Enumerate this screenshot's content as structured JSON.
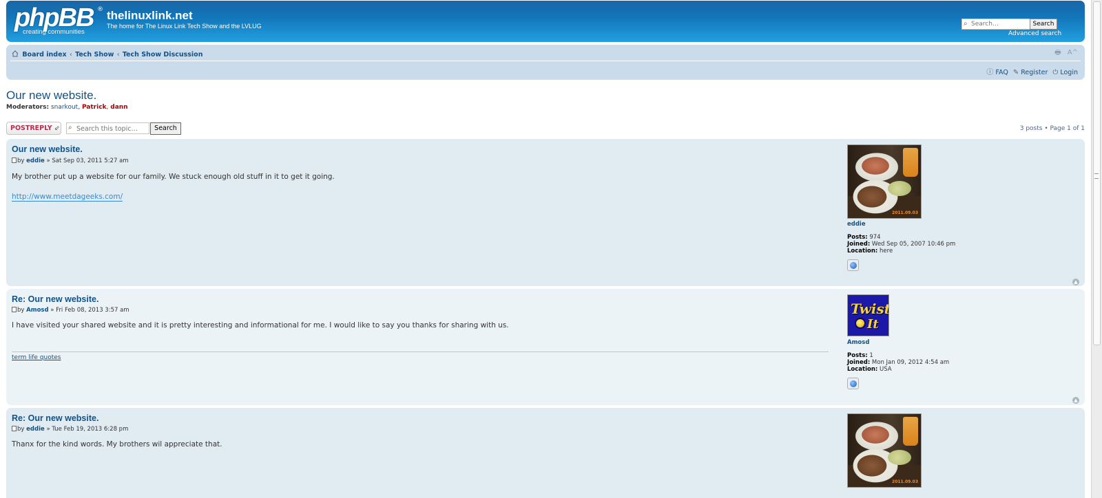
{
  "header": {
    "logo_main": "phpBB",
    "logo_reg": "®",
    "logo_sub": "creating communities",
    "site_title": "thelinuxlink.net",
    "site_desc": "The home for The Linux Link Tech Show and the LVLUG",
    "search_placeholder": "Search…",
    "search_button": "Search",
    "advanced_search": "Advanced search"
  },
  "breadcrumb": {
    "items": [
      "Board index",
      "Tech Show",
      "Tech Show Discussion"
    ],
    "separator": "‹"
  },
  "tools": {
    "print": "🖶",
    "font_size": "A^"
  },
  "usernav": {
    "faq": "FAQ",
    "register": "Register",
    "login": "Login"
  },
  "topic": {
    "title": "Our new website.",
    "moderators_label": "Moderators:",
    "moderators": [
      "snarkout",
      "Patrick",
      "dann"
    ]
  },
  "actions": {
    "post_reply": "POSTREPLY",
    "topic_search_placeholder": "Search this topic…",
    "topic_search_button": "Search",
    "pagination": "3 posts • Page 1 of 1"
  },
  "posts": [
    {
      "title": "Our new website.",
      "by": "by",
      "author": "eddie",
      "date": "» Sat Sep 03, 2011 5:27 am",
      "content": "My brother put up a website for our family. We stuck enough old stuff in it to get it going.",
      "link": "http://www.meetdageeks.com/",
      "profile": {
        "name": "eddie",
        "posts": "974",
        "joined": "Wed Sep 05, 2007 10:46 pm",
        "location": "here"
      }
    },
    {
      "title": "Re: Our new website.",
      "by": "by",
      "author": "Amosd",
      "date": "» Fri Feb 08, 2013 3:57 am",
      "content": "I have visited your shared website and it is pretty interesting and informational for me. I would like to say you thanks for sharing with us.",
      "signature": "term life quotes",
      "profile": {
        "name": "Amosd",
        "posts": "1",
        "joined": "Mon Jan 09, 2012 4:54 am",
        "location": "USA"
      }
    },
    {
      "title": "Re: Our new website.",
      "by": "by",
      "author": "eddie",
      "date": "» Tue Feb 19, 2013 6:28 pm",
      "content": "Thanx for the kind words. My brothers wil appreciate that."
    }
  ],
  "profile_labels": {
    "posts": "Posts:",
    "joined": "Joined:",
    "location": "Location:"
  },
  "avatar_text": {
    "twist_1": "Twist",
    "twist_2": "It",
    "stamp": "2011.09.03"
  },
  "colors": {
    "header": "#1276b9",
    "navbar": "#cadceb",
    "post_bg2": "#e1ebf2",
    "post_bg1": "#ecf3f7",
    "link": "#105289",
    "moderator_red": "#aa0000",
    "reply_button": "#bc2a4d"
  }
}
